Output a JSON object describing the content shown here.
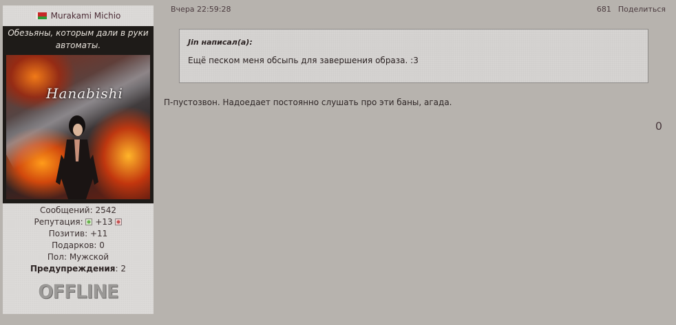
{
  "profile": {
    "username": "Murakami Michio",
    "flag_icon": "belarus-flag-icon",
    "status": "Обезьяны, которым дали в руки автоматы.",
    "avatar_text": "Hanabishi",
    "posts_label": "Сообщений:",
    "posts_value": "2542",
    "reputation_label": "Репутация:",
    "reputation_value": "+13",
    "positive_label": "Позитив:",
    "positive_value": "+11",
    "gifts_label": "Подарков:",
    "gifts_value": "0",
    "gender_label": "Пол:",
    "gender_value": "Мужской",
    "warnings_label": "Предупреждения",
    "warnings_value": "2",
    "online_status": "OFFLINE"
  },
  "post": {
    "date": "Вчера 22:59:28",
    "number": "681",
    "share_label": "Поделиться",
    "quote_author": "Jin написал(а):",
    "quote_text": "Ещё песком меня обсыпь для завершения образа. :3",
    "text": "П-пустозвон. Надоедает постоянно слушать про эти баны, агада.",
    "rating": "0"
  },
  "colors": {
    "page_bg": "#b7b3ae",
    "panel_bg": "#dcdad8",
    "status_bg": "#1e1b18",
    "name_color": "#4a2a34"
  }
}
